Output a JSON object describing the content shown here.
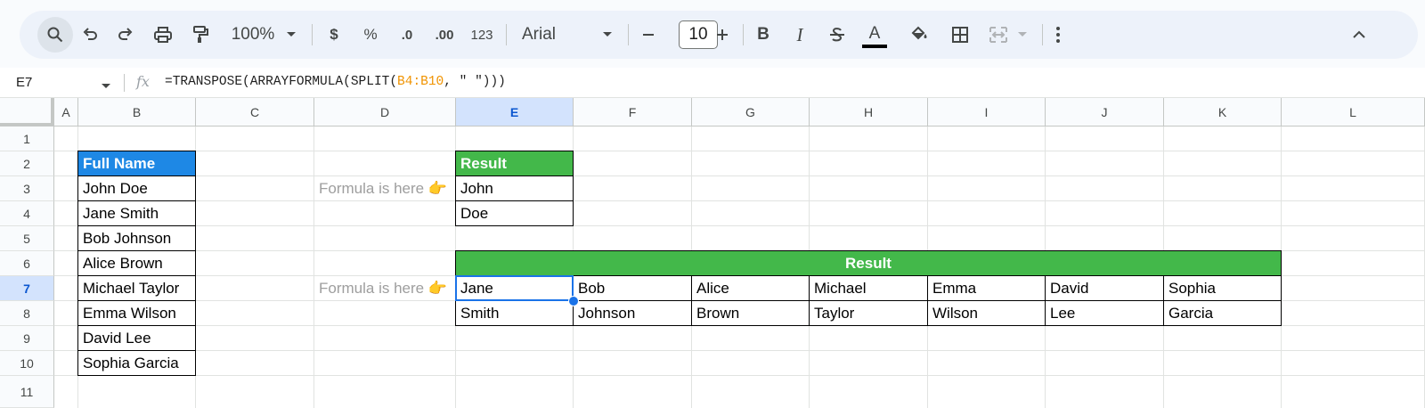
{
  "toolbar": {
    "zoom": "100%",
    "currency": "$",
    "percent": "%",
    "decrease_decimal": ".0",
    "increase_decimal": ".00",
    "number_format": "123",
    "font": "Arial",
    "font_size": "10",
    "bold": "B",
    "italic": "I",
    "text_color": "A"
  },
  "formula_bar": {
    "cell_ref": "E7",
    "fx": "fx",
    "formula_prefix": "=TRANSPOSE(ARRAYFORMULA(SPLIT(",
    "formula_ref": "B4:B10",
    "formula_suffix": ", \" \")))"
  },
  "columns": [
    "A",
    "B",
    "C",
    "D",
    "E",
    "F",
    "G",
    "H",
    "I",
    "J",
    "K",
    "L"
  ],
  "rows": [
    "1",
    "2",
    "3",
    "4",
    "5",
    "6",
    "7",
    "8",
    "9",
    "10",
    "11"
  ],
  "sheet": {
    "full_name_header": "Full Name",
    "full_names": [
      "John Doe",
      "Jane Smith",
      "Bob Johnson",
      "Alice Brown",
      "Michael Taylor",
      "Emma Wilson",
      "David Lee",
      "Sophia Garcia"
    ],
    "note_1": "Formula is here 👉",
    "note_2": "Formula is here 👉",
    "result_small_header": "Result",
    "result_small": [
      "John",
      "Doe"
    ],
    "result_large_header": "Result",
    "first_names": [
      "Jane",
      "Bob",
      "Alice",
      "Michael",
      "Emma",
      "David",
      "Sophia"
    ],
    "last_names": [
      "Smith",
      "Johnson",
      "Brown",
      "Taylor",
      "Wilson",
      "Lee",
      "Garcia"
    ]
  },
  "colors": {
    "blue_header": "#1e88e5",
    "green_header": "#43b84a",
    "selection": "#1a73e8",
    "formula_ref": "#f09300"
  }
}
